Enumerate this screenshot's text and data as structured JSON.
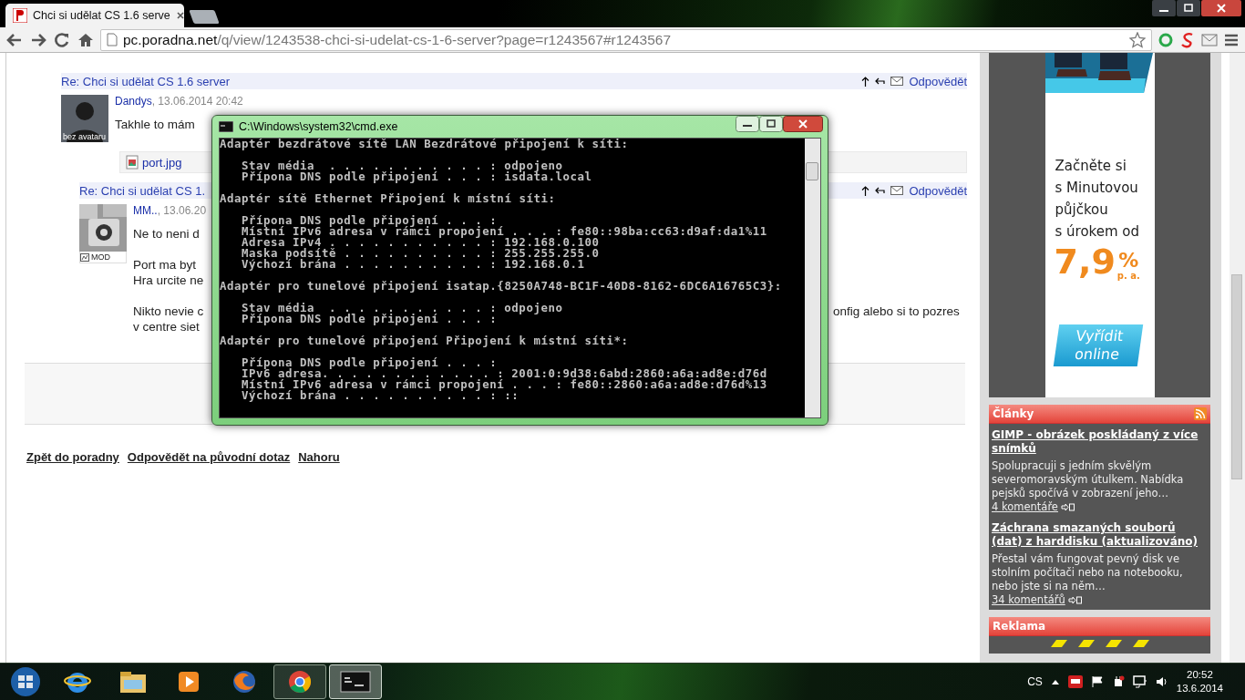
{
  "browser": {
    "tab": {
      "title": "Chci si udělat CS 1.6 serve",
      "selected": true
    },
    "url": {
      "host": "pc.poradna.net",
      "path": "/q/view/1243538-chci-si-udelat-cs-1-6-server?page=r1243567#r1243567"
    }
  },
  "posts": [
    {
      "heading": "Re: Chci si udělat CS 1.6 server",
      "reply": "Odpovědět",
      "avatar": {
        "kind": "silhouette",
        "label": "bez avataru"
      },
      "author": "Dandys",
      "date": ", 13.06.2014 20:42",
      "paragraphs": [
        [
          {
            "left": "Takhle to mám"
          }
        ]
      ],
      "attachment": "port.jpg"
    },
    {
      "heading": "Re: Chci si udělat CS 1.",
      "reply": "Odpovědět",
      "avatar": {
        "kind": "keyboard",
        "label": "MOD"
      },
      "author": "MM..",
      "date": ", 13.06.20",
      "paragraphs": [
        [
          {
            "left": "Ne to neni d"
          }
        ],
        [
          {
            "left": "Port ma byt"
          },
          {
            "left": "Hra urcite ne"
          }
        ],
        [
          {
            "left": "Nikto nevie c",
            "right": "onfig alebo si to pozres"
          },
          {
            "left": "v centre siet"
          }
        ]
      ]
    }
  ],
  "bottom_links": [
    "Zpět do poradny",
    "Odpovědět na původní dotaz",
    "Nahoru"
  ],
  "ad": {
    "lines": [
      "Začněte si",
      "s Minutovou",
      "půjčkou",
      "s úrokem od"
    ],
    "rate": "7,9",
    "percent": "%",
    "pa": "p. a.",
    "button": "Vyřídit online"
  },
  "articles_box": {
    "title": "Články",
    "items": [
      {
        "title": "GIMP - obrázek poskládaný z více snímků",
        "excerpt": "Spolupracuji s jedním skvělým severomoravským útulkem. Nabídka pejsků spočívá v zobrazení jeho…",
        "comments": "4 komentáře"
      },
      {
        "title": "Záchrana smazaných souborů (dat) z harddisku (aktualizováno)",
        "excerpt": "Přestal vám fungovat pevný disk ve stolním počítači nebo na notebooku, nebo jste si na něm…",
        "comments": "34 komentářů"
      }
    ]
  },
  "ads_box": {
    "title": "Reklama"
  },
  "console": {
    "title": "C:\\Windows\\system32\\cmd.exe",
    "sections": [
      {
        "heading": "Adaptér bezdrátové sítě LAN Bezdrátové připojení k síti:",
        "lines": [
          "Stav média  . . . . . . . . . . . : odpojeno",
          "Přípona DNS podle připojení . . . : isdata.local"
        ]
      },
      {
        "heading": "Adaptér sítě Ethernet Připojení k místní síti:",
        "lines": [
          "Přípona DNS podle připojení . . . :",
          "Místní IPv6 adresa v rámci propojení . . . : fe80::98ba:cc63:d9af:da1%11",
          "Adresa IPv4 . . . . . . . . . . . : 192.168.0.100",
          "Maska podsítě . . . . . . . . . . : 255.255.255.0",
          "Výchozí brána . . . . . . . . . . : 192.168.0.1"
        ]
      },
      {
        "heading": "Adaptér pro tunelové připojení isatap.{8250A748-BC1F-40D8-8162-6DC6A16765C3}:",
        "lines": [
          "Stav média  . . . . . . . . . . . : odpojeno",
          "Přípona DNS podle připojení . . . :"
        ]
      },
      {
        "heading": "Adaptér pro tunelové připojení Připojení k místní síti*:",
        "lines": [
          "Přípona DNS podle připojení . . . :",
          "IPv6 adresa. . . . . . . . . . . . : 2001:0:9d38:6abd:2860:a6a:ad8e:d76d",
          "Místní IPv6 adresa v rámci propojení . . . : fe80::2860:a6a:ad8e:d76d%13",
          "Výchozí brána . . . . . . . . . . : ::"
        ]
      }
    ]
  },
  "taskbar": {
    "apps": [
      {
        "kind": "ie",
        "running": false,
        "selected": false
      },
      {
        "kind": "explorer",
        "running": false,
        "selected": false
      },
      {
        "kind": "media",
        "running": false,
        "selected": false
      },
      {
        "kind": "firefox",
        "running": false,
        "selected": false
      },
      {
        "kind": "chrome",
        "running": true,
        "selected": false
      },
      {
        "kind": "console",
        "running": true,
        "selected": true
      }
    ],
    "language": "CS",
    "time": "20:52",
    "date": "13.6.2014"
  }
}
